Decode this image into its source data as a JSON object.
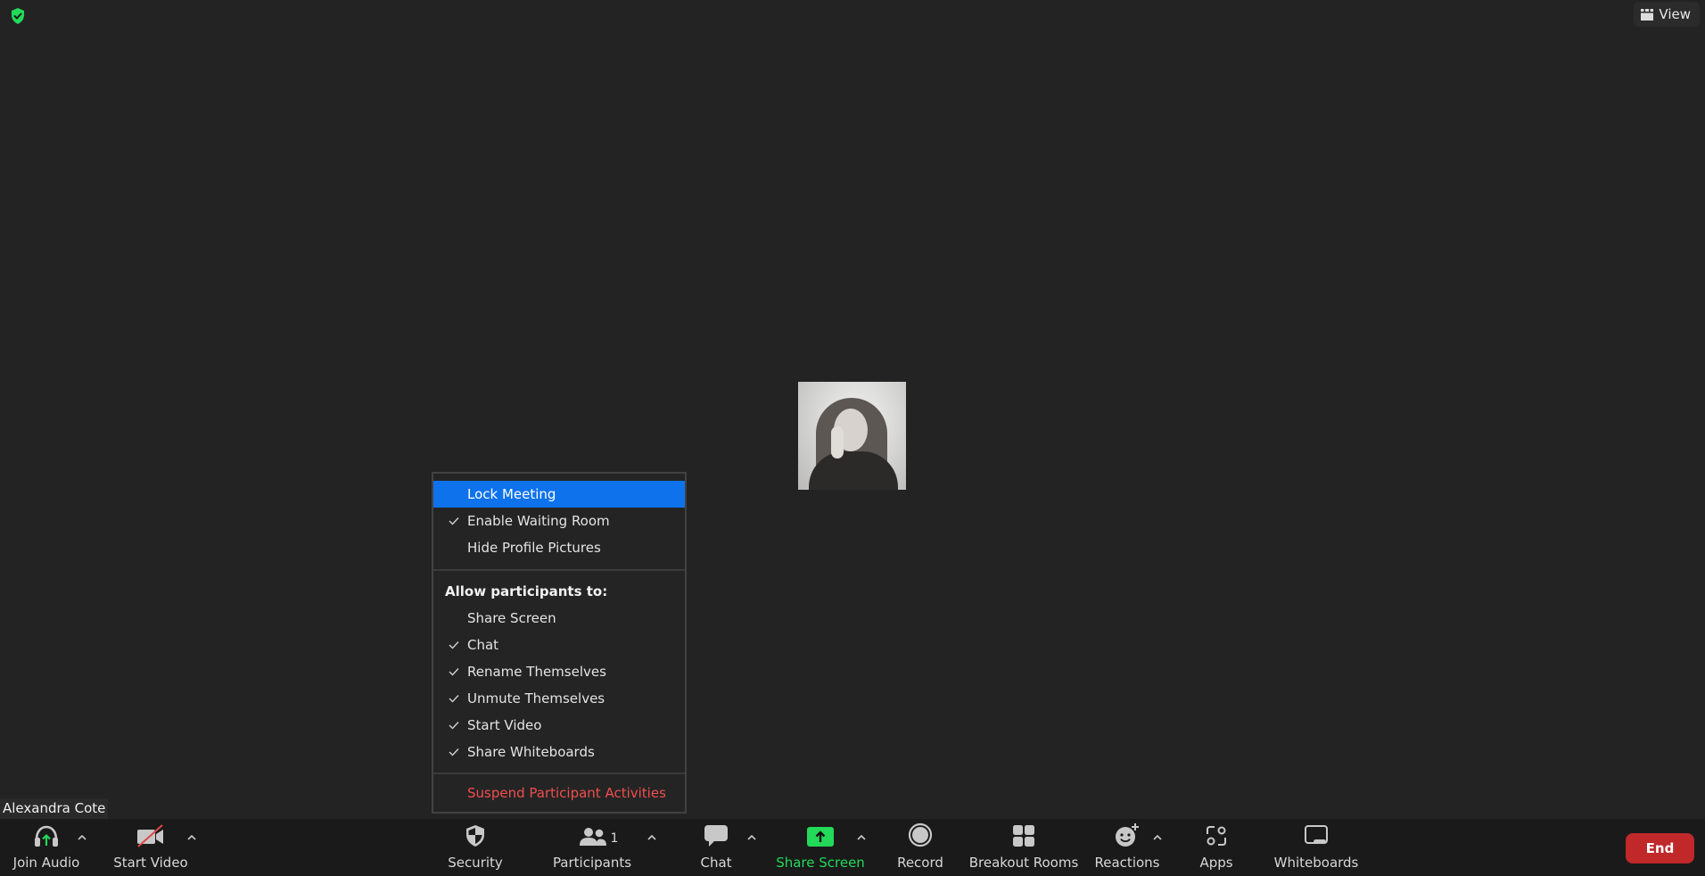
{
  "top": {
    "security_badge_icon": "shield-check-icon",
    "view_button": {
      "icon": "grid-view-icon",
      "label": "View"
    }
  },
  "video": {
    "participant_name": "Alexandra Cote",
    "avatar_description": "profile-photo"
  },
  "security_menu": {
    "items_top": [
      {
        "label": "Lock Meeting",
        "checked": false,
        "highlighted": true
      },
      {
        "label": "Enable Waiting Room",
        "checked": true,
        "highlighted": false
      },
      {
        "label": "Hide Profile Pictures",
        "checked": false,
        "highlighted": false
      }
    ],
    "heading": "Allow participants to:",
    "allow_items": [
      {
        "label": "Share Screen",
        "checked": false
      },
      {
        "label": "Chat",
        "checked": true
      },
      {
        "label": "Rename Themselves",
        "checked": true
      },
      {
        "label": "Unmute Themselves",
        "checked": true
      },
      {
        "label": "Start Video",
        "checked": true
      },
      {
        "label": "Share Whiteboards",
        "checked": true
      }
    ],
    "danger_item": "Suspend Participant Activities",
    "colors": {
      "highlight": "#0e72ed",
      "danger": "#f04e4e"
    }
  },
  "toolbar": {
    "join_audio": "Join Audio",
    "start_video": "Start Video",
    "security": "Security",
    "participants": "Participants",
    "participants_count": "1",
    "chat": "Chat",
    "share_screen": "Share Screen",
    "record": "Record",
    "breakout_rooms": "Breakout Rooms",
    "reactions": "Reactions",
    "apps": "Apps",
    "whiteboards": "Whiteboards",
    "end": "End",
    "colors": {
      "share_green": "#23d959",
      "end_red": "#c0282a"
    }
  }
}
